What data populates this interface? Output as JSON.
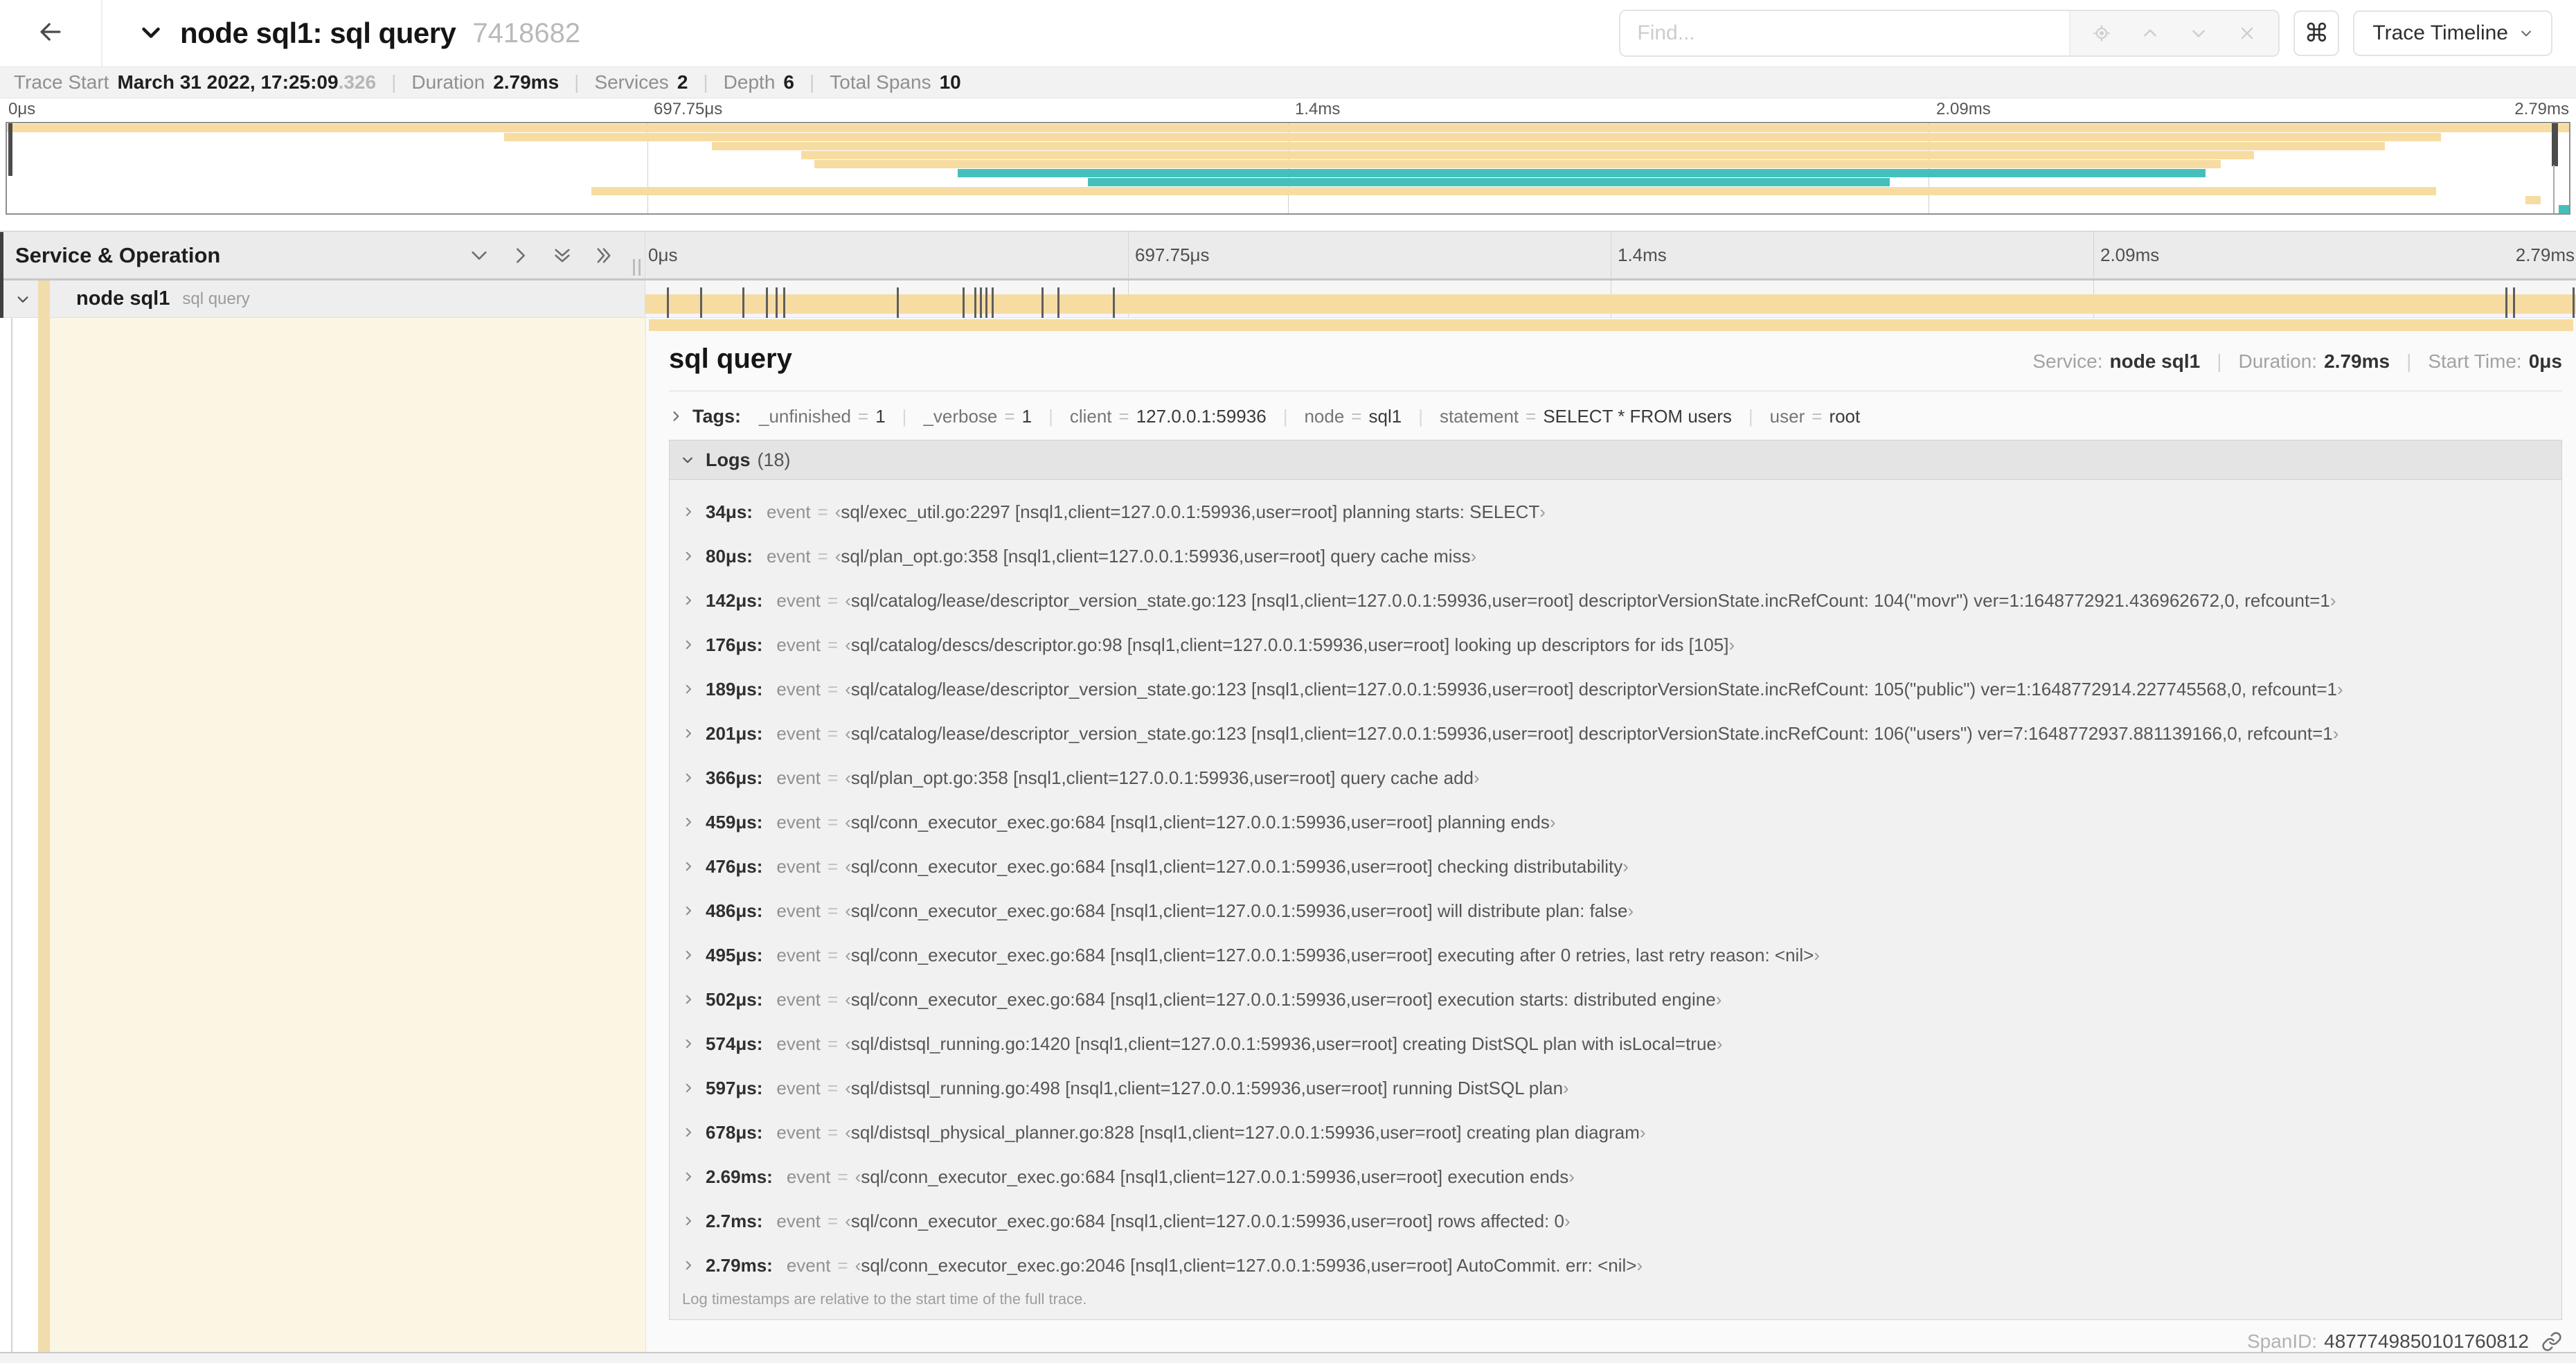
{
  "header": {
    "title": "node sql1: sql query",
    "trace_id": "7418682",
    "find_placeholder": "Find...",
    "shortcut_key": "⌘",
    "view_selector": "Trace Timeline"
  },
  "summary": {
    "items": [
      {
        "label": "Trace Start",
        "value": "March 31 2022, 17:25:09",
        "suffix": ".326"
      },
      {
        "label": "Duration",
        "value": "2.79ms"
      },
      {
        "label": "Services",
        "value": "2"
      },
      {
        "label": "Depth",
        "value": "6"
      },
      {
        "label": "Total Spans",
        "value": "10"
      }
    ]
  },
  "colors": {
    "span_tan": "#f7dca2",
    "span_teal": "#44c0bc",
    "accent_strip": "#f1dcab",
    "detail_cream": "#fbf5e4"
  },
  "timeline": {
    "axis_ticks": [
      "0μs",
      "697.75μs",
      "1.4ms",
      "2.09ms",
      "2.79ms"
    ],
    "left_header": "Service & Operation",
    "minimap_spans": [
      {
        "start": 0,
        "end": 100,
        "color": "tan"
      },
      {
        "start": 19.4,
        "end": 95.0,
        "color": "tan"
      },
      {
        "start": 27.5,
        "end": 92.8,
        "color": "tan"
      },
      {
        "start": 31.0,
        "end": 87.7,
        "color": "tan"
      },
      {
        "start": 31.5,
        "end": 86.4,
        "color": "tan"
      },
      {
        "start": 37.1,
        "end": 85.8,
        "color": "teal"
      },
      {
        "start": 42.2,
        "end": 73.5,
        "color": "teal"
      },
      {
        "start": 22.8,
        "end": 94.8,
        "color": "tan"
      },
      {
        "start": 98.3,
        "end": 98.9,
        "color": "tan"
      },
      {
        "start": 99.6,
        "end": 100,
        "color": "teal"
      }
    ],
    "span_row": {
      "service": "node sql1",
      "operation": "sql query"
    }
  },
  "detail": {
    "title": "sql query",
    "meta": [
      {
        "label": "Service:",
        "value": "node sql1"
      },
      {
        "label": "Duration:",
        "value": "2.79ms"
      },
      {
        "label": "Start Time:",
        "value": "0μs"
      }
    ],
    "tags_label": "Tags:",
    "tags": [
      {
        "key": "_unfinished",
        "value": "1"
      },
      {
        "key": "_verbose",
        "value": "1"
      },
      {
        "key": "client",
        "value": "127.0.0.1:59936"
      },
      {
        "key": "node",
        "value": "sql1"
      },
      {
        "key": "statement",
        "value": "SELECT * FROM users"
      },
      {
        "key": "user",
        "value": "root"
      }
    ],
    "logs_label": "Logs",
    "logs_count": "(18)",
    "logs": [
      {
        "time": "34μs",
        "pct": 1.2,
        "key": "event",
        "value": "sql/exec_util.go:2297 [nsql1,client=127.0.0.1:59936,user=root] planning starts: SELECT"
      },
      {
        "time": "80μs",
        "pct": 2.9,
        "key": "event",
        "value": "sql/plan_opt.go:358 [nsql1,client=127.0.0.1:59936,user=root] query cache miss"
      },
      {
        "time": "142μs",
        "pct": 5.1,
        "key": "event",
        "value": "sql/catalog/lease/descriptor_version_state.go:123 [nsql1,client=127.0.0.1:59936,user=root] descriptorVersionState.incRefCount: 104(\"movr\") ver=1:1648772921.436962672,0, refcount=1"
      },
      {
        "time": "176μs",
        "pct": 6.3,
        "key": "event",
        "value": "sql/catalog/descs/descriptor.go:98 [nsql1,client=127.0.0.1:59936,user=root] looking up descriptors for ids [105]"
      },
      {
        "time": "189μs",
        "pct": 6.8,
        "key": "event",
        "value": "sql/catalog/lease/descriptor_version_state.go:123 [nsql1,client=127.0.0.1:59936,user=root] descriptorVersionState.incRefCount: 105(\"public\") ver=1:1648772914.227745568,0, refcount=1"
      },
      {
        "time": "201μs",
        "pct": 7.2,
        "key": "event",
        "value": "sql/catalog/lease/descriptor_version_state.go:123 [nsql1,client=127.0.0.1:59936,user=root] descriptorVersionState.incRefCount: 106(\"users\") ver=7:1648772937.881139166,0, refcount=1"
      },
      {
        "time": "366μs",
        "pct": 13.1,
        "key": "event",
        "value": "sql/plan_opt.go:358 [nsql1,client=127.0.0.1:59936,user=root] query cache add"
      },
      {
        "time": "459μs",
        "pct": 16.5,
        "key": "event",
        "value": "sql/conn_executor_exec.go:684 [nsql1,client=127.0.0.1:59936,user=root] planning ends"
      },
      {
        "time": "476μs",
        "pct": 17.1,
        "key": "event",
        "value": "sql/conn_executor_exec.go:684 [nsql1,client=127.0.0.1:59936,user=root] checking distributability"
      },
      {
        "time": "486μs",
        "pct": 17.4,
        "key": "event",
        "value": "sql/conn_executor_exec.go:684 [nsql1,client=127.0.0.1:59936,user=root] will distribute plan: false"
      },
      {
        "time": "495μs",
        "pct": 17.7,
        "key": "event",
        "value": "sql/conn_executor_exec.go:684 [nsql1,client=127.0.0.1:59936,user=root] executing after 0 retries, last retry reason: <nil>"
      },
      {
        "time": "502μs",
        "pct": 18.0,
        "key": "event",
        "value": "sql/conn_executor_exec.go:684 [nsql1,client=127.0.0.1:59936,user=root] execution starts: distributed engine"
      },
      {
        "time": "574μs",
        "pct": 20.6,
        "key": "event",
        "value": "sql/distsql_running.go:1420 [nsql1,client=127.0.0.1:59936,user=root] creating DistSQL plan with isLocal=true"
      },
      {
        "time": "597μs",
        "pct": 21.4,
        "key": "event",
        "value": "sql/distsql_running.go:498 [nsql1,client=127.0.0.1:59936,user=root] running DistSQL plan"
      },
      {
        "time": "678μs",
        "pct": 24.3,
        "key": "event",
        "value": "sql/distsql_physical_planner.go:828 [nsql1,client=127.0.0.1:59936,user=root] creating plan diagram"
      },
      {
        "time": "2.69ms",
        "pct": 96.4,
        "key": "event",
        "value": "sql/conn_executor_exec.go:684 [nsql1,client=127.0.0.1:59936,user=root] execution ends"
      },
      {
        "time": "2.7ms",
        "pct": 96.8,
        "key": "event",
        "value": "sql/conn_executor_exec.go:684 [nsql1,client=127.0.0.1:59936,user=root] rows affected: 0"
      },
      {
        "time": "2.79ms",
        "pct": 99.9,
        "key": "event",
        "value": "sql/conn_executor_exec.go:2046 [nsql1,client=127.0.0.1:59936,user=root] AutoCommit. err: <nil>"
      }
    ],
    "logs_footer": "Log timestamps are relative to the start time of the full trace.",
    "span_id_label": "SpanID:",
    "span_id": "4877749850101760812"
  }
}
